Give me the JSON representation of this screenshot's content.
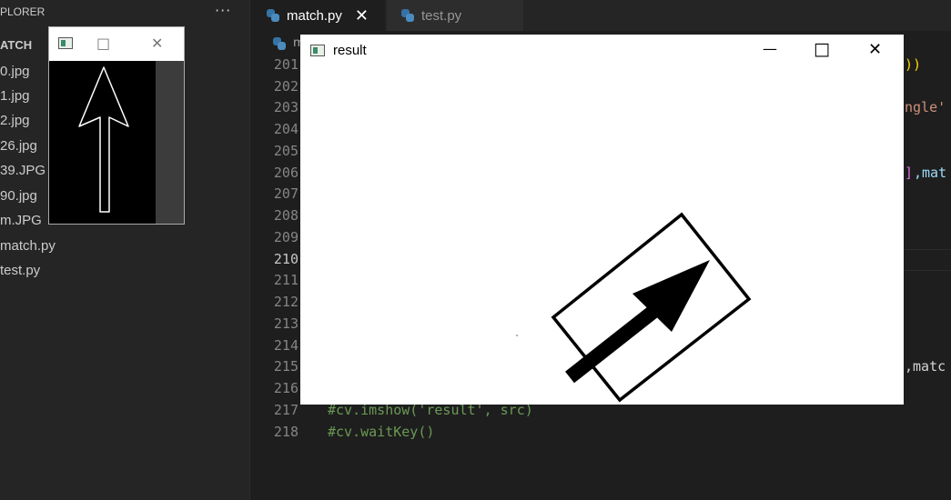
{
  "sidebar": {
    "title": "PLORER",
    "more": "···",
    "section": "ATCH",
    "files": [
      "0.jpg",
      "1.jpg",
      "2.jpg",
      "26.jpg",
      "39.JPG",
      "90.jpg",
      "m.JPG",
      "match.py",
      "test.py"
    ]
  },
  "tabs": [
    {
      "label": "match.py",
      "close": "✕"
    },
    {
      "label": "test.py"
    }
  ],
  "breadcrumb": {
    "text": "m"
  },
  "editor": {
    "line_numbers": [
      "201",
      "202",
      "203",
      "204",
      "205",
      "206",
      "207",
      "208",
      "209",
      "210",
      "211",
      "212",
      "213",
      "214",
      "215",
      "216",
      "217",
      "218"
    ],
    "current_line": "210",
    "line201_tail": "))",
    "line203_tail": "ngle'",
    "line206_tail_brk": "]",
    "line206_tail_var": ",mat",
    "line215_tail": ",matc",
    "line217": "#cv.imshow('result', src)",
    "line218": "#cv.waitKey()"
  },
  "small_window": {
    "minimize": "□",
    "close": "✕"
  },
  "result_window": {
    "title": "result",
    "minimize": "—",
    "maximize": "□",
    "close": "✕"
  },
  "colors": {
    "editor_bg": "#1e1e1e",
    "sidebar_bg": "#252526",
    "comment": "#6a9955",
    "string": "#ce9178",
    "variable": "#9cdcfe"
  }
}
